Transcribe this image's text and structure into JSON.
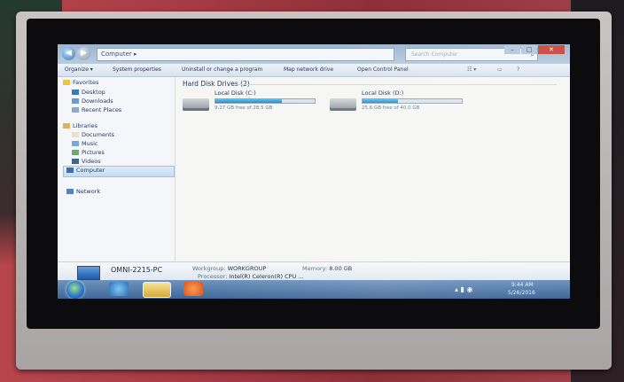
{
  "explorer": {
    "breadcrumb": "Computer ▸",
    "search_placeholder": "Search Computer",
    "toolbar": [
      "Organize ▾",
      "System properties",
      "Uninstall or change a program",
      "Map network drive",
      "Open Control Panel"
    ],
    "nav": {
      "favorites": "Favorites",
      "desktop": "Desktop",
      "downloads": "Downloads",
      "recent": "Recent Places",
      "libraries": "Libraries",
      "documents": "Documents",
      "music": "Music",
      "pictures": "Pictures",
      "videos": "Videos",
      "computer": "Computer",
      "network": "Network"
    },
    "group_header": "Hard Disk Drives (2)",
    "drives": [
      {
        "name": "Local Disk (C:)",
        "free_text": "9.27 GB free of 28.5 GB",
        "used_fraction": 0.67
      },
      {
        "name": "Local Disk (D:)",
        "free_text": "25.6 GB free of 40.0 GB",
        "used_fraction": 0.36
      }
    ],
    "details": {
      "pc_name": "OMNI-2215-PC",
      "workgroup_label": "Workgroup:",
      "workgroup": "WORKGROUP",
      "memory_label": "Memory:",
      "memory": "8.00 GB",
      "processor_label": "Processor:",
      "processor": "Intel(R) Celeron(R) CPU ..."
    }
  },
  "taskbar": {
    "time": "9:44 AM",
    "date": "5/26/2016"
  },
  "colors": {
    "titlebar": "#9bb5cf",
    "taskbar": "#4f77a6",
    "bezel": "#0c0c0e",
    "frame": "#c0bcbb",
    "background_cloth": "#a63b44"
  }
}
